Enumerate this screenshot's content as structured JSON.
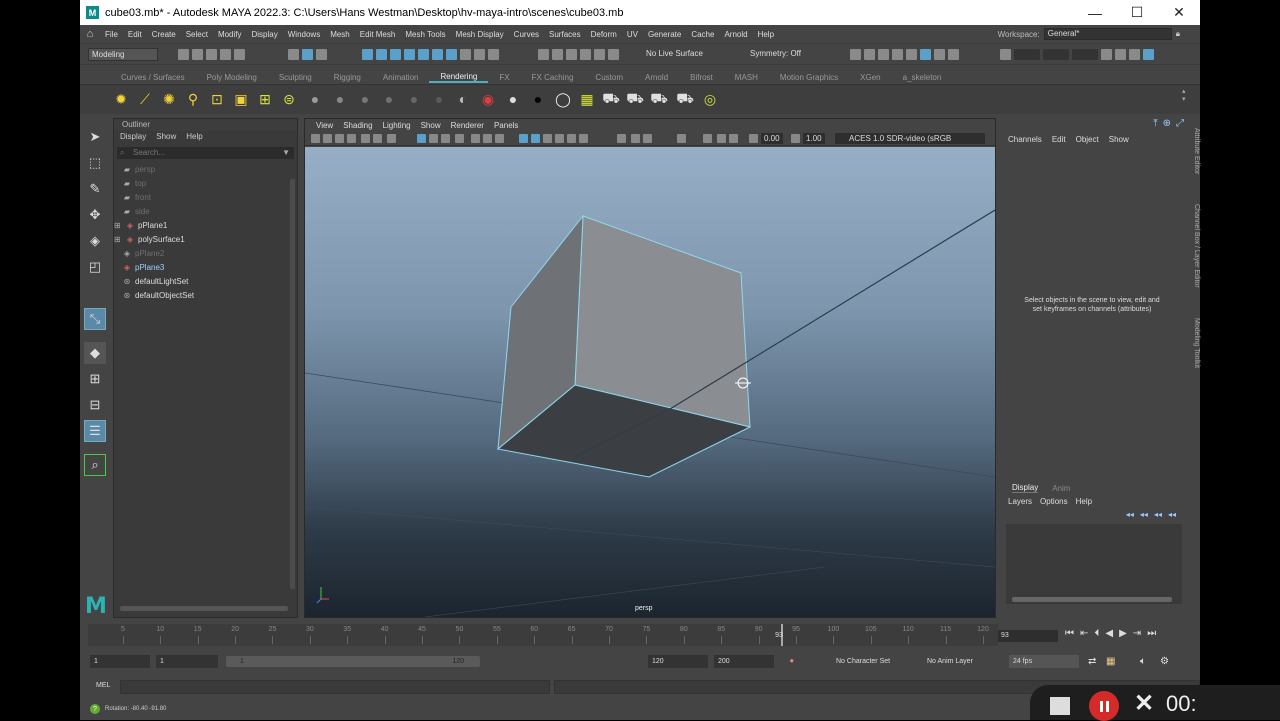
{
  "window": {
    "title": "cube03.mb* - Autodesk MAYA 2022.3: C:\\Users\\Hans Westman\\Desktop\\hv-maya-intro\\scenes\\cube03.mb",
    "logo": "M",
    "minimize": "—",
    "maximize": "☐",
    "close": "✕"
  },
  "menubar": {
    "items": [
      "File",
      "Edit",
      "Create",
      "Select",
      "Modify",
      "Display",
      "Windows",
      "Mesh",
      "Edit Mesh",
      "Mesh Tools",
      "Mesh Display",
      "Curves",
      "Surfaces",
      "Deform",
      "UV",
      "Generate",
      "Cache",
      "Arnold",
      "Help"
    ],
    "workspace_label": "Workspace:",
    "workspace_value": "General*"
  },
  "statusline": {
    "mode": "Modeling",
    "live_surface": "No Live Surface",
    "symmetry": "Symmetry: Off"
  },
  "shelf": {
    "tabs": [
      "Curves / Surfaces",
      "Poly Modeling",
      "Sculpting",
      "Rigging",
      "Animation",
      "Rendering",
      "FX",
      "FX Caching",
      "Custom",
      "Arnold",
      "Bifrost",
      "MASH",
      "Motion Graphics",
      "XGen",
      "a_skeleton"
    ],
    "active_tab": "Rendering"
  },
  "outliner": {
    "title": "Outliner",
    "menu": [
      "Display",
      "Show",
      "Help"
    ],
    "search_placeholder": "Search...",
    "items": [
      {
        "name": "persp",
        "dim": true,
        "type": "camera"
      },
      {
        "name": "top",
        "dim": true,
        "type": "camera"
      },
      {
        "name": "front",
        "dim": true,
        "type": "camera"
      },
      {
        "name": "side",
        "dim": true,
        "type": "camera"
      },
      {
        "name": "pPlane1",
        "dim": false,
        "type": "mesh",
        "expand": "+"
      },
      {
        "name": "polySurface1",
        "dim": false,
        "type": "mesh",
        "expand": "+"
      },
      {
        "name": "pPlane2",
        "dim": true,
        "type": "mesh"
      },
      {
        "name": "pPlane3",
        "dim": false,
        "type": "mesh",
        "highlight": true
      },
      {
        "name": "defaultLightSet",
        "dim": false,
        "type": "set"
      },
      {
        "name": "defaultObjectSet",
        "dim": false,
        "type": "set"
      }
    ]
  },
  "viewport": {
    "menu": [
      "View",
      "Shading",
      "Lighting",
      "Show",
      "Renderer",
      "Panels"
    ],
    "exposure": "0.00",
    "gamma": "1.00",
    "colorspace": "ACES 1.0 SDR-video (sRGB",
    "camera_label": "persp"
  },
  "channelbox": {
    "menu": [
      "Channels",
      "Edit",
      "Object",
      "Show"
    ],
    "message": "Select objects in the scene to view, edit and set keyframes on channels (attributes)",
    "side_tabs": [
      "Attribute Editor",
      "Channel Box / Layer Editor",
      "Modeling Toolkit"
    ]
  },
  "layers": {
    "tabs": [
      "Display",
      "Anim"
    ],
    "active_tab": "Display",
    "menu": [
      "Layers",
      "Options",
      "Help"
    ]
  },
  "timeslider": {
    "ticks": [
      5,
      10,
      15,
      20,
      25,
      30,
      35,
      40,
      45,
      50,
      55,
      60,
      65,
      70,
      75,
      80,
      85,
      90,
      95,
      100,
      105,
      110,
      115,
      120
    ],
    "min": 1,
    "max": 120,
    "current_frame": "93",
    "current_field": "93"
  },
  "range": {
    "start": "1",
    "playback_start": "1",
    "slider_start": "1",
    "slider_end": "120",
    "playback_end": "120",
    "end": "200",
    "character_set": "No Character Set",
    "anim_layer": "No Anim Layer",
    "fps": "24 fps"
  },
  "cmdline": {
    "label": "MEL"
  },
  "helpline": {
    "text": "Rotation:   -80.40    -91.80"
  },
  "recorder": {
    "timer": "00:"
  },
  "colors": {
    "accent": "#5aa0c8",
    "selection_edge": "#8fd8ee",
    "record_red": "#d42a2a"
  }
}
